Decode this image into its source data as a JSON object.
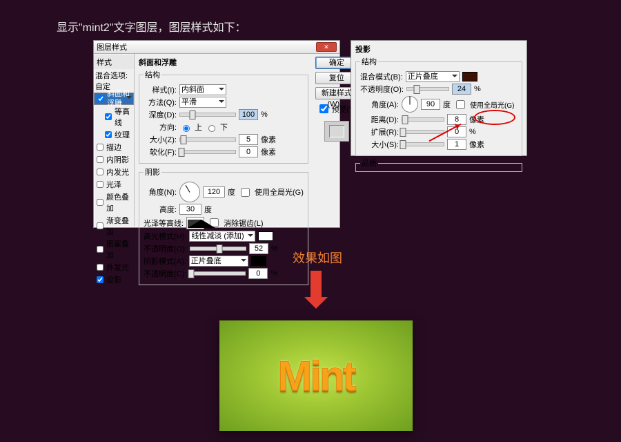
{
  "caption_top": "显示\"mint2\"文字图层，图层样式如下：",
  "caption_mid": "效果如图",
  "dialog1": {
    "title": "图层样式",
    "styles_header": "样式",
    "blend_options": "混合选项:自定",
    "list": [
      "斜面和浮雕",
      "等高线",
      "纹理",
      "描边",
      "内阴影",
      "内发光",
      "光泽",
      "颜色叠加",
      "渐变叠加",
      "图案叠加",
      "外发光",
      "投影"
    ],
    "checked": {
      "斜面和浮雕": true,
      "等高线": true,
      "纹理": true,
      "投影": true
    },
    "selected": "斜面和浮雕",
    "section_title": "斜面和浮雕",
    "group_structure": "结构",
    "style_label": "样式(I):",
    "style_value": "内斜面",
    "technique_label": "方法(Q):",
    "technique_value": "平滑",
    "depth_label": "深度(D):",
    "depth_value": "100",
    "depth_unit": "%",
    "direction_label": "方向:",
    "direction_up": "上",
    "direction_down": "下",
    "size_label": "大小(Z):",
    "size_value": "5",
    "size_unit": "像素",
    "soften_label": "软化(F):",
    "soften_value": "0",
    "soften_unit": "像素",
    "group_shading": "阴影",
    "angle_label": "角度(N):",
    "angle_value": "120",
    "angle_unit": "度",
    "use_global_light": "使用全局光(G)",
    "altitude_label": "高度:",
    "altitude_value": "30",
    "altitude_unit": "度",
    "gloss_contour_label": "光泽等高线:",
    "anti_alias": "消除锯齿(L)",
    "highlight_mode_label": "高光模式(H):",
    "highlight_mode_value": "线性减淡 (添加)",
    "highlight_opacity_label": "不透明度(O):",
    "highlight_opacity_value": "52",
    "highlight_opacity_unit": "%",
    "shadow_mode_label": "阴影模式(A):",
    "shadow_mode_value": "正片叠底",
    "shadow_opacity_label": "不透明度(C):",
    "shadow_opacity_value": "0",
    "shadow_opacity_unit": "%",
    "btn_ok": "确定",
    "btn_cancel": "复位",
    "btn_newstyle": "新建样式(W)...",
    "preview": "预览(V)"
  },
  "dialog2": {
    "section_title": "投影",
    "group_structure": "结构",
    "blend_mode_label": "混合模式(B):",
    "blend_mode_value": "正片叠底",
    "opacity_label": "不透明度(O):",
    "opacity_value": "24",
    "opacity_unit": "%",
    "angle_label": "角度(A):",
    "angle_value": "90",
    "angle_unit": "度",
    "use_global_light": "使用全局光(G)",
    "distance_label": "距离(D):",
    "distance_value": "8",
    "distance_unit": "像素",
    "spread_label": "扩展(R):",
    "spread_value": "0",
    "spread_unit": "%",
    "size_label": "大小(S):",
    "size_value": "1",
    "size_unit": "像素",
    "group_quality": "品质"
  },
  "result_text": "Mint"
}
